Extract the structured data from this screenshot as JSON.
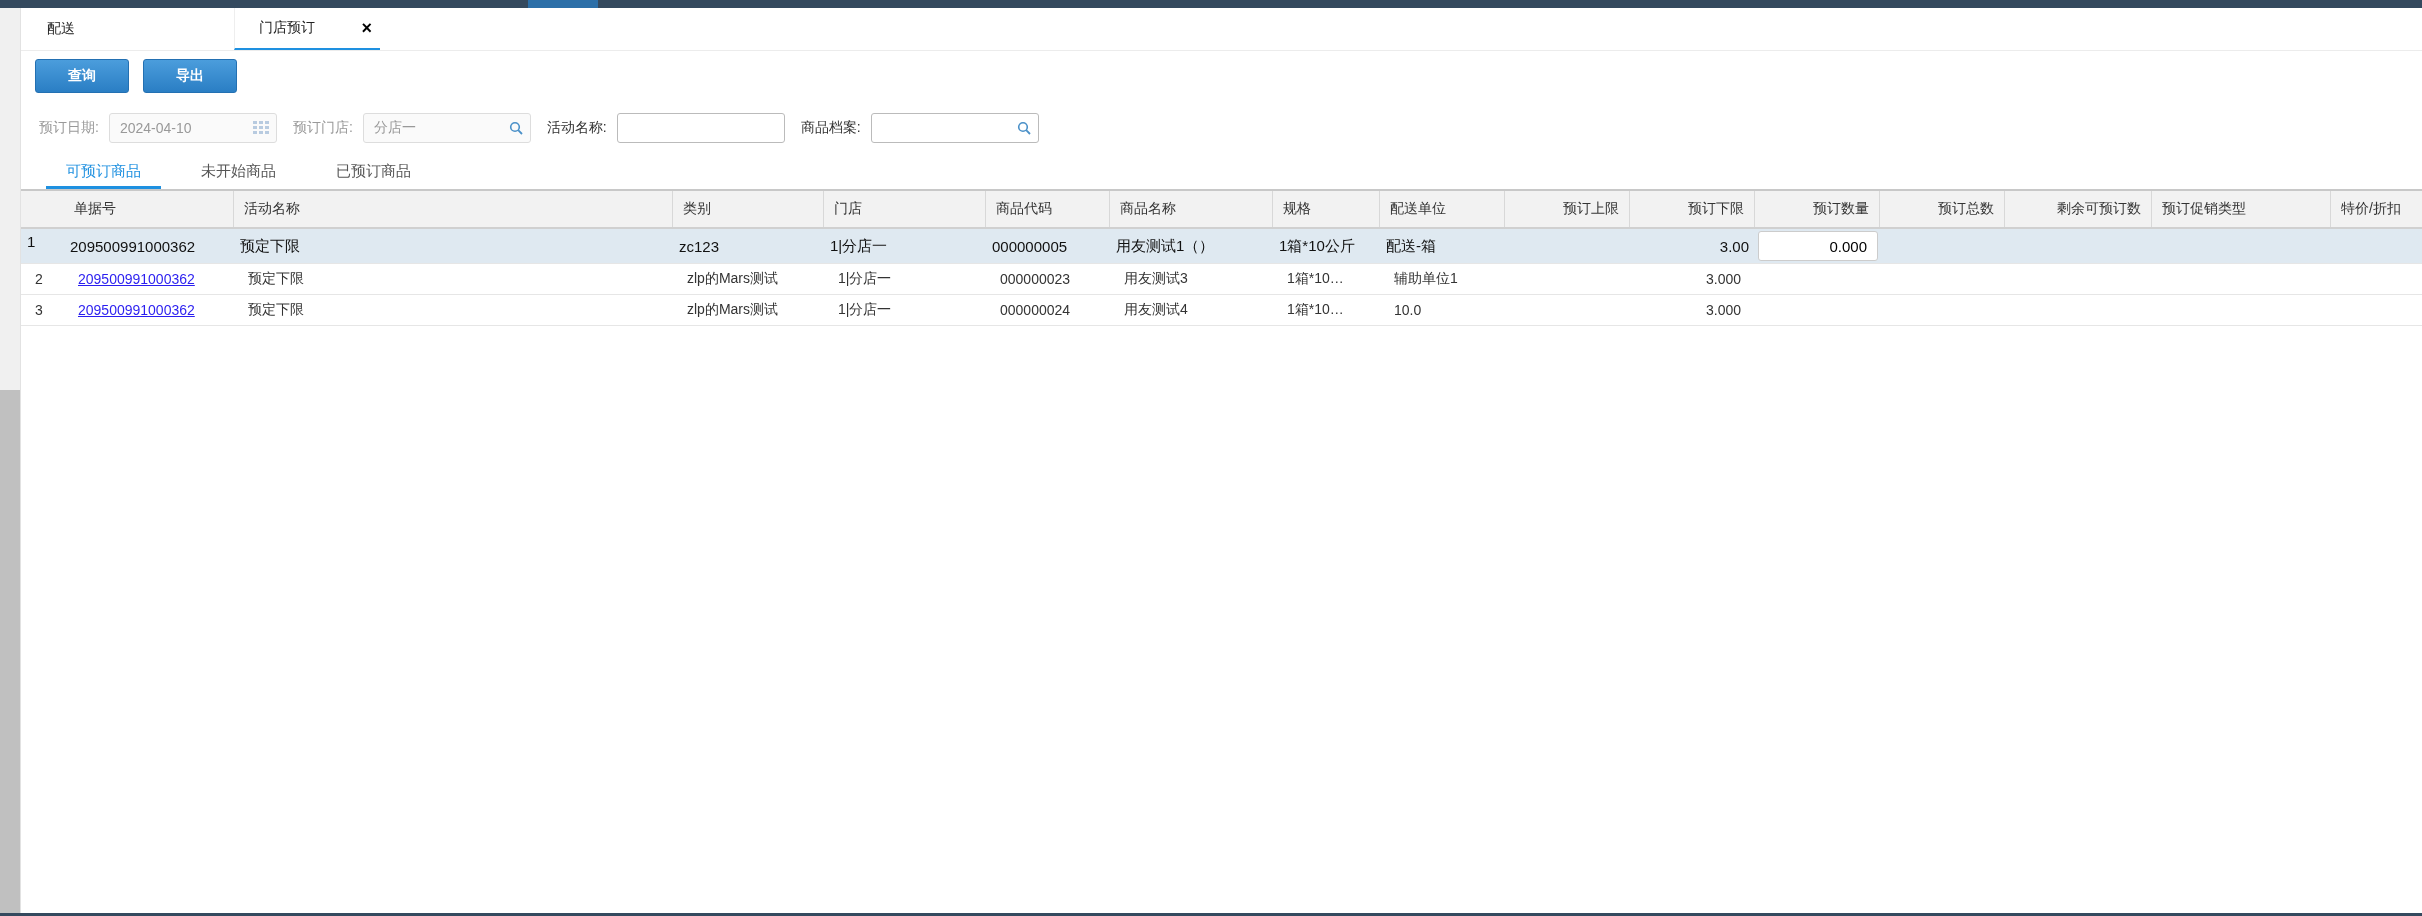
{
  "page_tabs": [
    {
      "label": "配送",
      "selected": false
    },
    {
      "label": "门店预订",
      "selected": true,
      "close": "×"
    }
  ],
  "buttons": [
    "查询",
    "导出"
  ],
  "filters": [
    {
      "kind": "date",
      "label": "预订日期:",
      "value": "2024-04-10",
      "disabled": true
    },
    {
      "kind": "lookup",
      "label": "预订门店:",
      "value": "分店一",
      "disabled": true
    },
    {
      "kind": "text",
      "label": "活动名称:",
      "disabled": false
    },
    {
      "kind": "lookup",
      "label": "商品档案:",
      "disabled": false
    }
  ],
  "sub_tabs": [
    {
      "label": "可预订商品",
      "selected": true
    },
    {
      "label": "未开始商品",
      "selected": false
    },
    {
      "label": "已预订商品",
      "selected": false
    }
  ],
  "table": {
    "columns": [
      {},
      {
        "label": "单据号"
      },
      {
        "label": "活动名称"
      },
      {
        "label": "类别"
      },
      {
        "label": "门店"
      },
      {
        "label": "商品代码"
      },
      {
        "label": "商品名称"
      },
      {
        "label": "规格"
      },
      {
        "label": "配送单位"
      },
      {
        "label": "预订上限"
      },
      {
        "label": "预订下限"
      },
      {
        "label": "预订数量"
      },
      {
        "label": "预订总数"
      },
      {
        "label": "剩余可预订数"
      },
      {
        "label": "预订促销类型"
      },
      {
        "label": "特价/折扣"
      }
    ],
    "rows": [
      {
        "kind": "edit",
        "selected": true,
        "cells": [
          "1",
          "209500991000362",
          "预定下限",
          "zc123",
          "1|分店一",
          "000000005",
          "用友测试1（）",
          "1箱*10公斤",
          "配送-箱",
          null,
          "3.00",
          "0.000",
          null,
          null,
          null,
          null
        ]
      },
      {
        "kind": "view",
        "selected": false,
        "cells": [
          "2",
          "209500991000362",
          "预定下限",
          "zlp的Mars测试",
          "1|分店一",
          "000000023",
          "用友测试3",
          "1箱*10…",
          "辅助单位1",
          null,
          "3.000",
          null,
          null,
          null,
          null,
          null
        ]
      },
      {
        "kind": "view",
        "selected": false,
        "cells": [
          "3",
          "209500991000362",
          "预定下限",
          "zlp的Mars测试",
          "1|分店一",
          "000000024",
          "用友测试4",
          "1箱*10…",
          "10.0",
          null,
          "3.000",
          null,
          null,
          null,
          null,
          null
        ]
      }
    ]
  }
}
